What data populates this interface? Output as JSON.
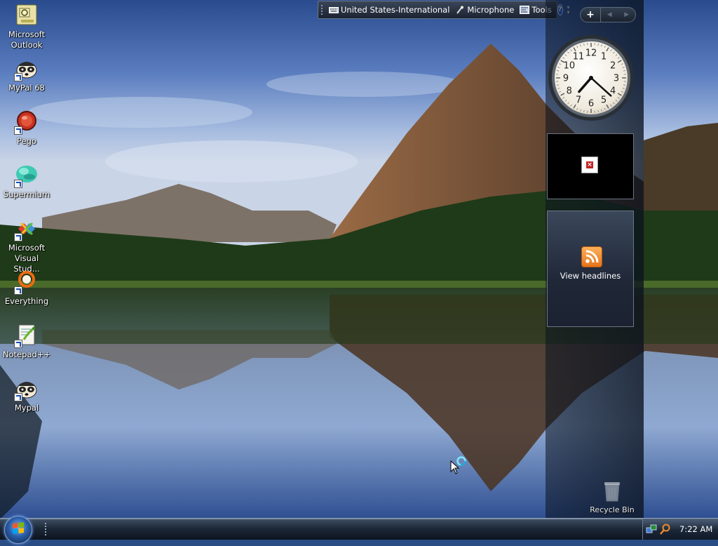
{
  "desktop": {
    "icons": [
      {
        "label": "Microsoft Outlook",
        "icon": "outlook-icon",
        "shortcut": false
      },
      {
        "label": "MyPal 68",
        "icon": "mypal-icon",
        "shortcut": true
      },
      {
        "label": "Pego",
        "icon": "pego-icon",
        "shortcut": true
      },
      {
        "label": "Supermium",
        "icon": "supermium-icon",
        "shortcut": true
      },
      {
        "label": "Microsoft Visual Stud...",
        "icon": "visual-studio-icon",
        "shortcut": true
      },
      {
        "label": "Everything",
        "icon": "everything-icon",
        "shortcut": true
      },
      {
        "label": "Notepad++",
        "icon": "notepadpp-icon",
        "shortcut": true
      },
      {
        "label": "Mypal",
        "icon": "mypal-icon",
        "shortcut": true
      }
    ],
    "recycle_bin": {
      "label": "Recycle Bin",
      "icon": "recycle-bin-icon"
    }
  },
  "language_bar": {
    "language": "United States-International",
    "microphone": "Microphone",
    "tools": "Tools",
    "help": "?"
  },
  "sidebar": {
    "add_button": "+",
    "clock": {
      "hour": 7,
      "minute": 22,
      "numerals": [
        "12",
        "1",
        "2",
        "3",
        "4",
        "5",
        "6",
        "7",
        "8",
        "9",
        "10",
        "11"
      ]
    },
    "feed_gadget": {
      "label": "View headlines"
    }
  },
  "taskbar": {
    "time": "7:22 AM"
  },
  "colors": {
    "sky_top": "#2b4f95",
    "rss_orange": "#e2731a",
    "taskbar": "#1b2635"
  }
}
